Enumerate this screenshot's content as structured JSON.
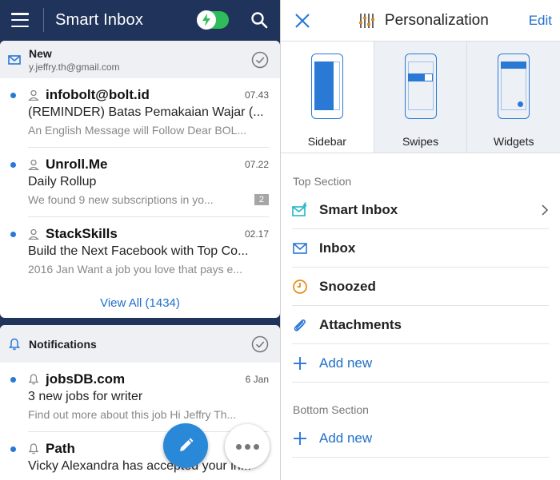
{
  "left": {
    "app_title": "Smart Inbox",
    "new_section": {
      "title": "New",
      "account": "y.jeffry.th@gmail.com",
      "emails": [
        {
          "sender": "infobolt@bolt.id",
          "time": "07.43",
          "subject": "(REMINDER) Batas Pemakaian Wajar (...",
          "preview": "An English Message will Follow Dear BOL...",
          "badge": ""
        },
        {
          "sender": "Unroll.Me",
          "time": "07.22",
          "subject": "Daily Rollup",
          "preview": "We found 9 new subscriptions in yo...",
          "badge": "2"
        },
        {
          "sender": "StackSkills",
          "time": "02.17",
          "subject": "Build the Next Facebook with Top Co...",
          "preview": "2016 Jan Want a job you love that pays e...",
          "badge": ""
        }
      ],
      "view_all": "View All (1434)"
    },
    "notifications_section": {
      "title": "Notifications",
      "emails": [
        {
          "sender": "jobsDB.com",
          "time": "6 Jan",
          "subject": "3 new jobs for writer",
          "preview": "Find out more about this job Hi Jeffry Th..."
        },
        {
          "sender": "Path",
          "time": "",
          "subject": "Vicky Alexandra has accepted your in...",
          "preview": ""
        }
      ]
    }
  },
  "right": {
    "title": "Personalization",
    "edit_label": "Edit",
    "layout_tabs": [
      {
        "label": "Sidebar",
        "active": true
      },
      {
        "label": "Swipes",
        "active": false
      },
      {
        "label": "Widgets",
        "active": false
      }
    ],
    "top_section_label": "Top Section",
    "top_items": [
      {
        "label": "Smart Inbox",
        "icon": "smart-inbox-icon"
      },
      {
        "label": "Inbox",
        "icon": "envelope-icon"
      },
      {
        "label": "Snoozed",
        "icon": "clock-icon"
      },
      {
        "label": "Attachments",
        "icon": "paperclip-icon"
      }
    ],
    "add_new_label": "Add new",
    "bottom_section_label": "Bottom Section"
  },
  "colors": {
    "header_bg": "#20335a",
    "accent_blue": "#2a78d6",
    "toggle_green": "#2ebd5a",
    "snooze_orange": "#e88a1a"
  }
}
